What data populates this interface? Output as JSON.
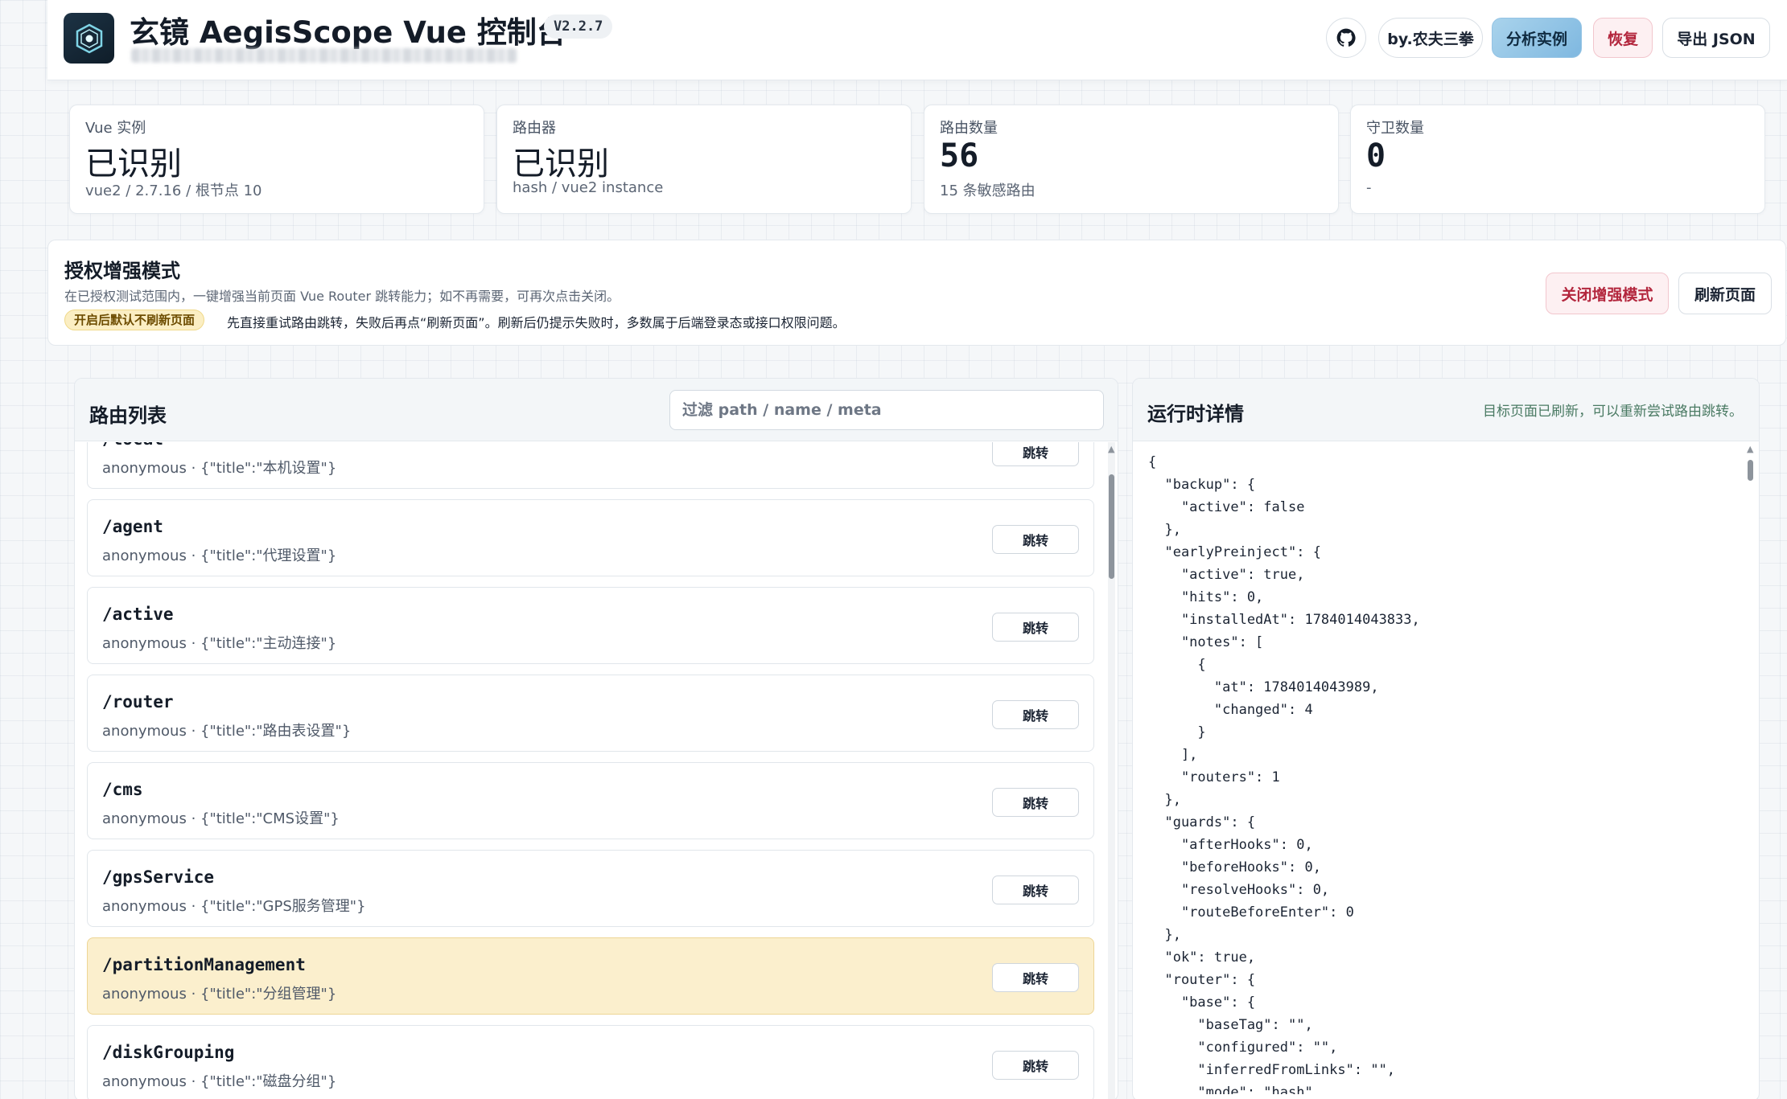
{
  "header": {
    "title": "玄镜 AegisScope Vue 控制台",
    "version": "V2.2.7",
    "buttons": {
      "github_icon": "github-icon",
      "author": "by.农夫三拳",
      "analyze": "分析实例",
      "restore": "恢复",
      "export": "导出 JSON"
    }
  },
  "stats": [
    {
      "label": "Vue 实例",
      "value": "已识别",
      "sub": "vue2 / 2.7.16 / 根节点 10"
    },
    {
      "label": "路由器",
      "value": "已识别",
      "sub": "hash / vue2 instance"
    },
    {
      "label": "路由数量",
      "value": "56",
      "sub": "15 条敏感路由"
    },
    {
      "label": "守卫数量",
      "value": "0",
      "sub": "-"
    }
  ],
  "auth": {
    "title": "授权增强模式",
    "desc": "在已授权测试范围内，一键增强当前页面 Vue Router 跳转能力；如不再需要，可再次点击关闭。",
    "badge": "开启后默认不刷新页面",
    "note": "先直接重试路由跳转，失败后再点“刷新页面”。刷新后仍提示失败时，多数属于后端登录态或接口权限问题。",
    "close_button": "关闭增强模式",
    "refresh_button": "刷新页面"
  },
  "routes": {
    "title": "路由列表",
    "filter_placeholder": "过滤 path / name / meta",
    "jump_label": "跳转",
    "items": [
      {
        "path": "/local",
        "meta": "anonymous · {\"title\":\"本机设置\"}",
        "active": false
      },
      {
        "path": "/agent",
        "meta": "anonymous · {\"title\":\"代理设置\"}",
        "active": false
      },
      {
        "path": "/active",
        "meta": "anonymous · {\"title\":\"主动连接\"}",
        "active": false
      },
      {
        "path": "/router",
        "meta": "anonymous · {\"title\":\"路由表设置\"}",
        "active": false
      },
      {
        "path": "/cms",
        "meta": "anonymous · {\"title\":\"CMS设置\"}",
        "active": false
      },
      {
        "path": "/gpsService",
        "meta": "anonymous · {\"title\":\"GPS服务管理\"}",
        "active": false
      },
      {
        "path": "/partitionManagement",
        "meta": "anonymous · {\"title\":\"分组管理\"}",
        "active": true
      },
      {
        "path": "/diskGrouping",
        "meta": "anonymous · {\"title\":\"磁盘分组\"}",
        "active": false
      }
    ]
  },
  "runtime": {
    "title": "运行时详情",
    "status": "目标页面已刷新，可以重新尝试路由跳转。",
    "json_lines": [
      "{",
      "  \"backup\": {",
      "    \"active\": false",
      "  },",
      "  \"earlyPreinject\": {",
      "    \"active\": true,",
      "    \"hits\": 0,",
      "    \"installedAt\": 1784014043833,",
      "    \"notes\": [",
      "      {",
      "        \"at\": 1784014043989,",
      "        \"changed\": 4",
      "      }",
      "    ],",
      "    \"routers\": 1",
      "  },",
      "  \"guards\": {",
      "    \"afterHooks\": 0,",
      "    \"beforeHooks\": 0,",
      "    \"resolveHooks\": 0,",
      "    \"routeBeforeEnter\": 0",
      "  },",
      "  \"ok\": true,",
      "  \"router\": {",
      "    \"base\": {",
      "      \"baseTag\": \"\",",
      "      \"configured\": \"\",",
      "      \"inferredFromLinks\": \"\",",
      "      \"mode\": \"hash\""
    ]
  }
}
